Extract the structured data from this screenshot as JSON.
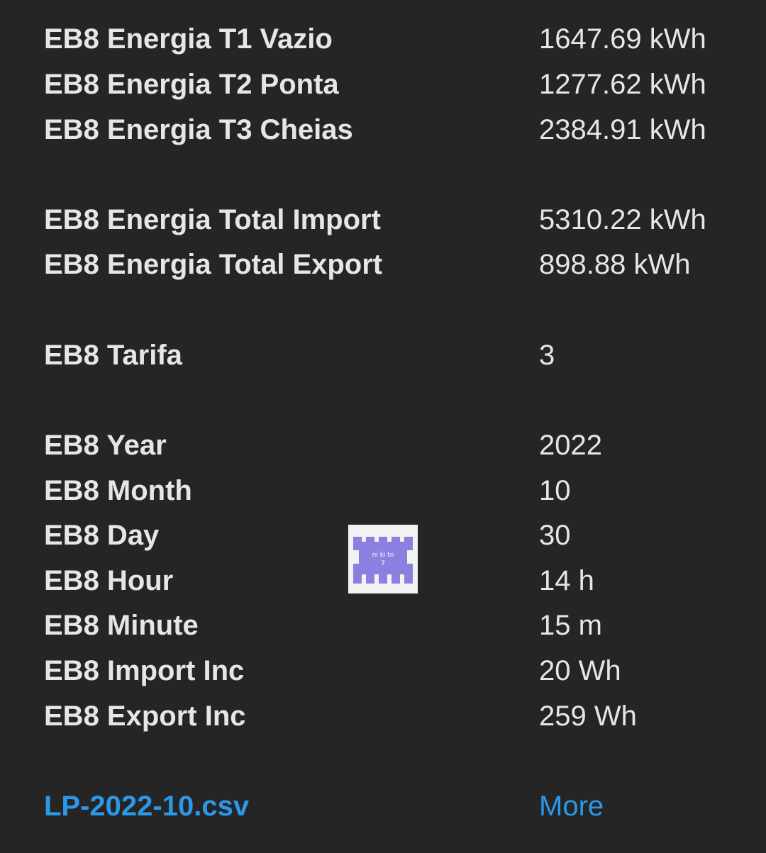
{
  "rows": [
    {
      "label": "EB8 Energia T1 Vazio",
      "value": "1647.69 kWh"
    },
    {
      "label": "EB8 Energia T2 Ponta",
      "value": "1277.62 kWh"
    },
    {
      "label": "EB8 Energia T3 Cheias",
      "value": "2384.91 kWh"
    },
    {
      "label": "EB8 Energia Total Import",
      "value": "5310.22 kWh"
    },
    {
      "label": "EB8 Energia Total Export",
      "value": "898.88 kWh"
    },
    {
      "label": "EB8 Tarifa",
      "value": "3"
    },
    {
      "label": "EB8 Year",
      "value": "2022"
    },
    {
      "label": "EB8 Month",
      "value": "10"
    },
    {
      "label": "EB8 Day",
      "value": "30"
    },
    {
      "label": "EB8 Hour",
      "value": "14 h"
    },
    {
      "label": "EB8 Minute",
      "value": "15 m"
    },
    {
      "label": "EB8 Import Inc",
      "value": "20 Wh"
    },
    {
      "label": "EB8 Export Inc",
      "value": "259 Wh"
    }
  ],
  "footer": {
    "file_link": "LP-2022-10.csv",
    "more_link": "More"
  },
  "logo": {
    "line1": "ni ki to",
    "line2": "7",
    "color": "#8a80e0"
  }
}
